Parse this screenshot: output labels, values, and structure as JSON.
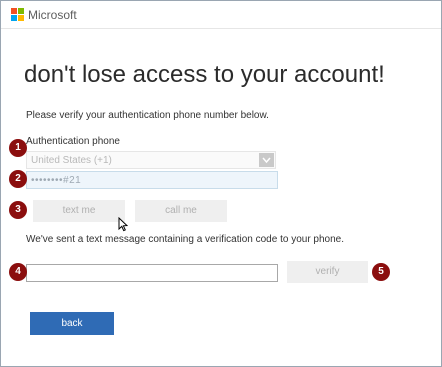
{
  "header": {
    "brand": "Microsoft",
    "logo_colors": [
      "#f25022",
      "#7fba00",
      "#00a4ef",
      "#ffb900"
    ]
  },
  "main": {
    "title": "don't lose access to your account!",
    "intro": "Please verify your authentication phone number below.",
    "phone_label": "Authentication phone",
    "country_value": "United States (+1)",
    "phone_value": "••••••••#21",
    "text_me_label": "text me",
    "call_me_label": "call me",
    "sent_message": "We've sent a text message containing a verification code to your phone.",
    "code_value": "",
    "verify_label": "verify",
    "back_label": "back"
  },
  "markers": [
    "1",
    "2",
    "3",
    "4",
    "5"
  ],
  "colors": {
    "accent": "#2f6bb5",
    "marker": "#8b0e0e"
  }
}
